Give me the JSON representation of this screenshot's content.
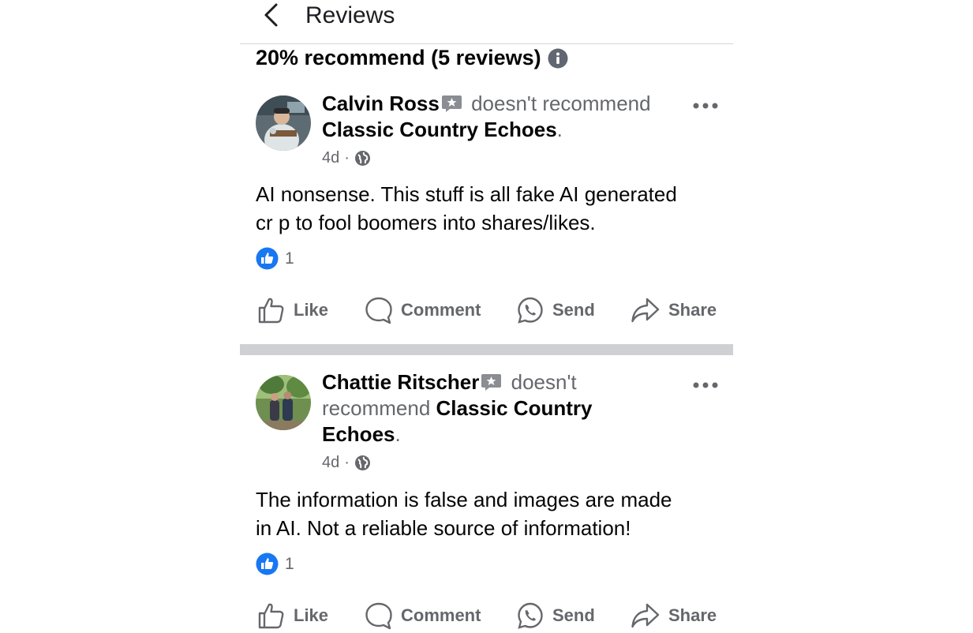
{
  "header": {
    "title": "Reviews",
    "back_icon": "chevron-left-icon"
  },
  "summary": {
    "text": "20% recommend (5 reviews)",
    "info_icon": "info-icon"
  },
  "reviews": [
    {
      "author": "Calvin Ross",
      "verdict_inline": "doesn't recommend",
      "verdict_wrap": "",
      "page": "Classic Country Echoes",
      "time": "4d",
      "body_line1": "AI nonsense. This stuff is all fake AI generated",
      "body_line2": "cr  p to fool boomers into shares/likes.",
      "like_count": "1"
    },
    {
      "author": "Chattie Ritscher",
      "verdict_inline": "doesn't",
      "verdict_wrap": "recommend",
      "page": "Classic Country",
      "page_wrap": "Echoes",
      "time": "4d",
      "body_line1": "The information is false and images are made",
      "body_line2": "in AI. Not a reliable source of information!",
      "like_count": "1"
    }
  ],
  "actions": {
    "like": "Like",
    "comment": "Comment",
    "send": "Send",
    "share": "Share"
  },
  "colors": {
    "like_blue": "#1877f2",
    "text_grey": "#65676b",
    "divider": "#ced0d4"
  }
}
